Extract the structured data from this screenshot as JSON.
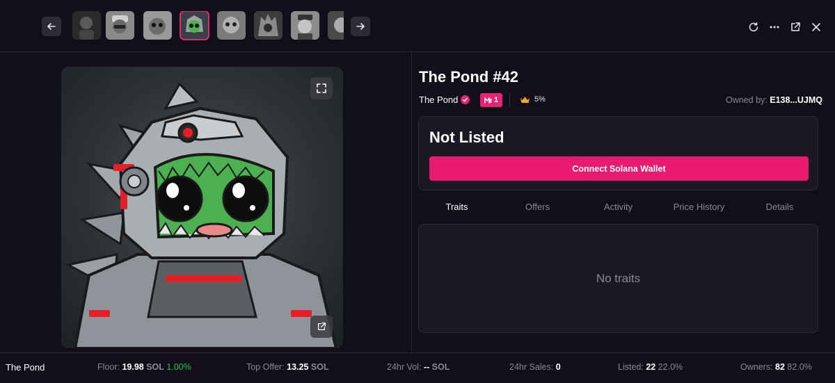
{
  "nav": {
    "prev_icon": "arrow-left-icon",
    "next_icon": "arrow-right-icon",
    "thumbnails": [
      {
        "name": "thumbnail-1",
        "active": false
      },
      {
        "name": "thumbnail-2",
        "active": false
      },
      {
        "name": "thumbnail-3",
        "active": false
      },
      {
        "name": "thumbnail-4",
        "active": true
      },
      {
        "name": "thumbnail-5",
        "active": false
      },
      {
        "name": "thumbnail-6",
        "active": false
      },
      {
        "name": "thumbnail-7",
        "active": false
      },
      {
        "name": "thumbnail-8",
        "active": false
      }
    ],
    "actions": [
      "refresh-icon",
      "more-icon",
      "external-link-icon",
      "close-icon"
    ]
  },
  "item": {
    "title": "The Pond #42",
    "collection": "The Pond",
    "badge_count": "1",
    "royalty": "5%",
    "owner_label": "Owned by:",
    "owner_address": "E138...UJMQ"
  },
  "listing": {
    "status": "Not Listed",
    "connect_label": "Connect Solana Wallet"
  },
  "tabs": [
    "Traits",
    "Offers",
    "Activity",
    "Price History",
    "Details"
  ],
  "active_tab": "Traits",
  "traits": {
    "empty_message": "No traits"
  },
  "stats": {
    "collection": "The Pond",
    "floor_label": "Floor:",
    "floor_value": "19.98",
    "floor_unit": "SOL",
    "floor_change": "1.00%",
    "top_offer_label": "Top Offer:",
    "top_offer_value": "13.25",
    "top_offer_unit": "SOL",
    "vol_label": "24hr Vol:",
    "vol_value": "--",
    "vol_unit": "SOL",
    "sales_label": "24hr Sales:",
    "sales_value": "0",
    "listed_label": "Listed:",
    "listed_value": "22",
    "listed_pct": "22.0%",
    "owners_label": "Owners:",
    "owners_value": "82",
    "owners_pct": "82.0%"
  },
  "colors": {
    "background": "#120f1a",
    "panel": "#1b1724",
    "accent": "#e81a6e",
    "positive": "#22c55e",
    "muted": "#8d8798"
  }
}
